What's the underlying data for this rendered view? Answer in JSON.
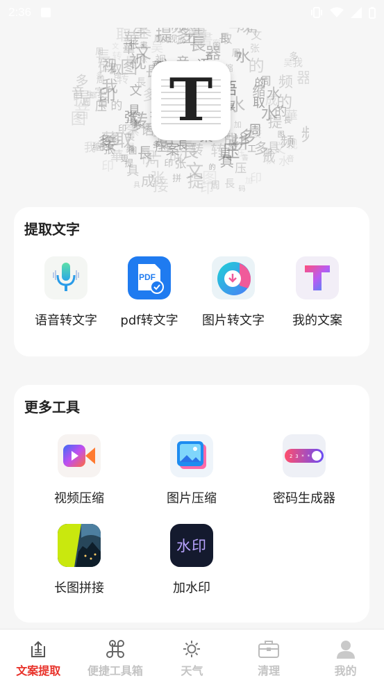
{
  "status_bar": {
    "time": "2:36",
    "icons": [
      "notification-icon",
      "vibrate-icon",
      "wifi-icon",
      "signal-icon",
      "battery-icon"
    ]
  },
  "hero": {
    "logo_letter": "T",
    "background_chars": [
      "文",
      "字",
      "提",
      "取",
      "语",
      "音",
      "图",
      "片",
      "案",
      "张",
      "吴",
      "周",
      "華",
      "秦",
      "書",
      "印",
      "水",
      "長",
      "拼",
      "接",
      "工",
      "具",
      "码",
      "生",
      "成",
      "器",
      "视",
      "频",
      "压",
      "缩",
      "更",
      "多",
      "我",
      "的",
      "转",
      "加"
    ]
  },
  "extract_section": {
    "title": "提取文字",
    "items": [
      {
        "label": "语音转文字",
        "icon": "microphone-icon"
      },
      {
        "label": "pdf转文字",
        "icon": "pdf-icon"
      },
      {
        "label": "图片转文字",
        "icon": "image-download-icon"
      },
      {
        "label": "我的文案",
        "icon": "text-t-icon"
      }
    ]
  },
  "tools_section": {
    "title": "更多工具",
    "items": [
      {
        "label": "视频压缩",
        "icon": "video-camera-icon"
      },
      {
        "label": "图片压缩",
        "icon": "photo-icon"
      },
      {
        "label": "密码生成器",
        "icon": "password-toggle-icon",
        "display": "2 3 * *"
      },
      {
        "label": "长图拼接",
        "icon": "long-image-icon"
      },
      {
        "label": "加水印",
        "icon": "watermark-icon",
        "display": "水印"
      }
    ]
  },
  "bottom_nav": {
    "items": [
      {
        "label": "文案提取",
        "icon": "document-upload-icon",
        "active": true
      },
      {
        "label": "便捷工具箱",
        "icon": "command-icon",
        "active": false
      },
      {
        "label": "天气",
        "icon": "sun-icon",
        "active": false
      },
      {
        "label": "清理",
        "icon": "briefcase-icon",
        "active": false
      },
      {
        "label": "我的",
        "icon": "user-icon",
        "active": false
      }
    ]
  },
  "colors": {
    "accent": "#e8322a",
    "inactive": "#c4c4c4",
    "background": "#f6f6f6",
    "card": "#ffffff"
  }
}
